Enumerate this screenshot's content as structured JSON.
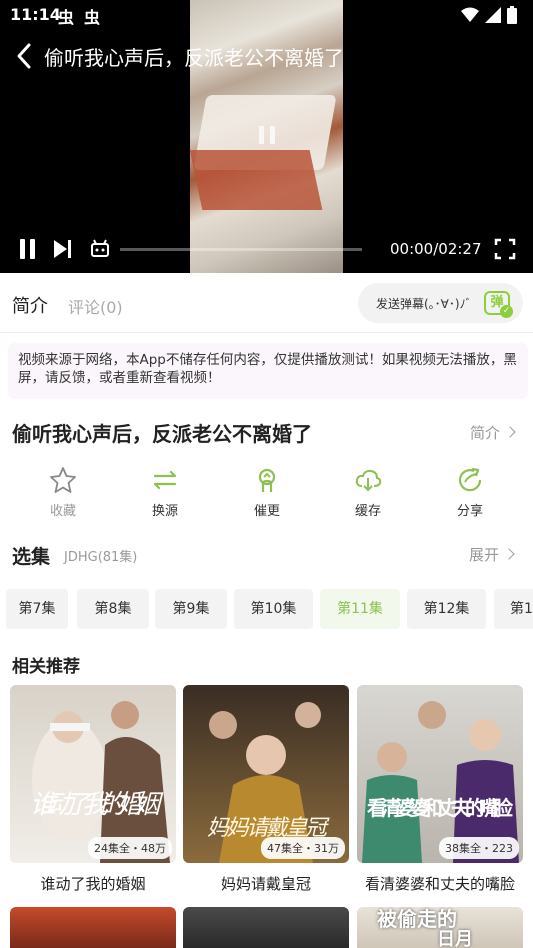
{
  "status": {
    "time": "11:14",
    "notif_icons": [
      "bug-icon",
      "bug-icon"
    ],
    "right_icons": [
      "wifi-icon",
      "signal-icon",
      "battery-icon"
    ]
  },
  "player": {
    "title": "偷听我心声后，反派老公不离婚了",
    "time": "00:00/02:27",
    "progress": 0
  },
  "tabs": {
    "intro": "简介",
    "comments": "评论(0)",
    "danmaku_placeholder": "发送弹幕(｡･∀･)ﾉﾞ",
    "danmaku_icon": "弹"
  },
  "notice": "视频来源于网络，本App不储存任何内容，仅提供播放测试！如果视频无法播放，黑屏，请反馈，或者重新查看视频！",
  "show": {
    "title": "偷听我心声后，反派老公不离婚了",
    "intro_link": "简介"
  },
  "actions": [
    {
      "label": "收藏",
      "icon": "star-icon"
    },
    {
      "label": "换源",
      "icon": "switch-source-icon"
    },
    {
      "label": "催更",
      "icon": "urge-update-icon"
    },
    {
      "label": "缓存",
      "icon": "download-cloud-icon"
    },
    {
      "label": "分享",
      "icon": "share-icon"
    }
  ],
  "episodes": {
    "title": "选集",
    "source": "JDHG(81集)",
    "expand": "展开",
    "items": [
      "第7集",
      "第8集",
      "第9集",
      "第10集",
      "第11集",
      "第12集",
      "第1"
    ],
    "active_index": 4
  },
  "recommend": {
    "title": "相关推荐",
    "items": [
      {
        "name": "谁动了我的婚姻",
        "badge": "24集全・48万",
        "poster_text": "谁动了我的婚姻"
      },
      {
        "name": "妈妈请戴皇冠",
        "badge": "47集全・31万",
        "poster_text": "妈妈请戴皇冠"
      },
      {
        "name": "看清婆婆和丈夫的嘴脸",
        "badge": "38集全・223",
        "poster_text": "看清婆婆和丈夫的嘴脸"
      }
    ],
    "partial_poster_texts": [
      "被偷走的",
      "日月"
    ]
  },
  "colors": {
    "accent": "#8cc152",
    "notice_bg": "#fbf6fb"
  }
}
